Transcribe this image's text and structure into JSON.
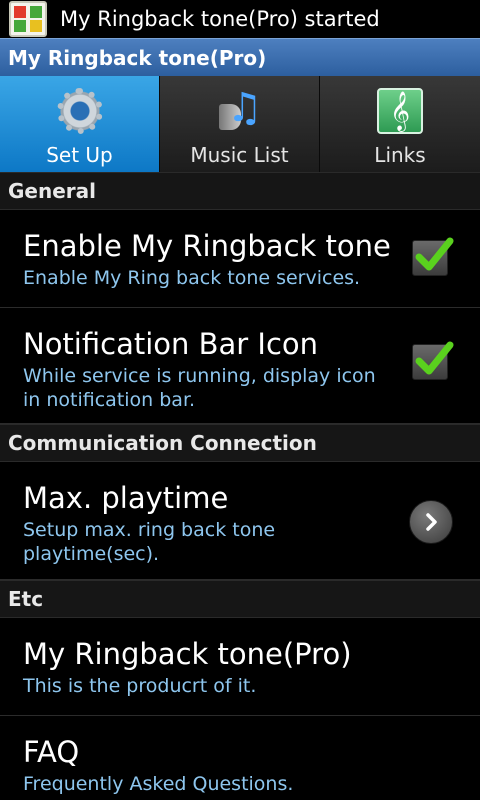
{
  "status_bar": {
    "notification_icon": "app-icon",
    "text": "My Ringback tone(Pro) started"
  },
  "app_title": "My Ringback tone(Pro)",
  "tabs": [
    {
      "label": "Set Up",
      "icon": "gear-icon",
      "selected": true
    },
    {
      "label": "Music List",
      "icon": "music-note-icon",
      "selected": false
    },
    {
      "label": "Links",
      "icon": "treble-clef-icon",
      "selected": false
    }
  ],
  "sections": {
    "general": "General",
    "communication": "Communication Connection",
    "etc": "Etc"
  },
  "prefs": {
    "enable": {
      "title": "Enable My Ringback tone",
      "summary": "Enable My Ring back tone services.",
      "checked": true
    },
    "notify": {
      "title": "Notification Bar Icon",
      "summary": "While service is running, display icon in notification bar.",
      "checked": true
    },
    "playtime": {
      "title": "Max. playtime",
      "summary": "Setup max. ring back tone playtime(sec)."
    },
    "product": {
      "title": "My Ringback tone(Pro)",
      "summary": "This is the producrt of it."
    },
    "faq": {
      "title": "FAQ",
      "summary": "Frequently Asked Questions."
    }
  },
  "colors": {
    "selected_tab": "#1e8fd8",
    "title_bar": "#3d6fb0",
    "summary_text": "#8ec6ee",
    "check_mark": "#5ad11e"
  }
}
